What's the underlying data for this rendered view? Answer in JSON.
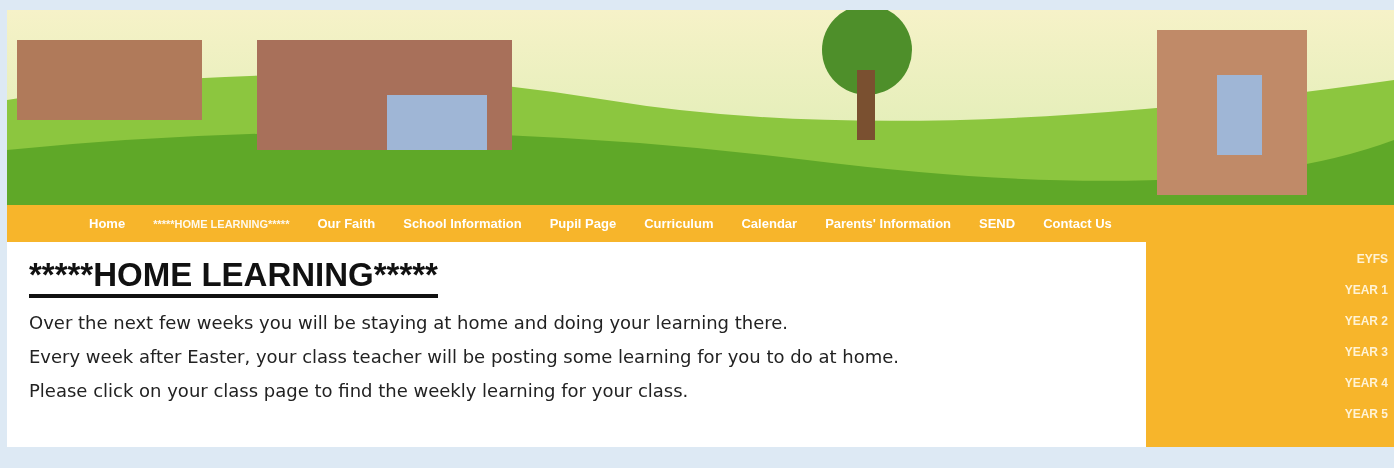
{
  "nav": [
    {
      "label": "Home",
      "selected": false
    },
    {
      "label": "*****HOME LEARNING*****",
      "selected": true
    },
    {
      "label": "Our Faith",
      "selected": false
    },
    {
      "label": "School Information",
      "selected": false
    },
    {
      "label": "Pupil Page",
      "selected": false
    },
    {
      "label": "Curriculum",
      "selected": false
    },
    {
      "label": "Calendar",
      "selected": false
    },
    {
      "label": "Parents' Information",
      "selected": false
    },
    {
      "label": "SEND",
      "selected": false
    },
    {
      "label": "Contact Us",
      "selected": false
    }
  ],
  "page": {
    "title": "*****HOME LEARNING*****",
    "paragraphs": [
      "Over the next few weeks you will be staying at home and doing your learning there.",
      "Every week after Easter, your class teacher will be posting some learning for you to do at home.",
      "Please click on your class page to find the weekly learning for your class."
    ]
  },
  "sidebar": {
    "items": [
      "EYFS",
      "YEAR 1",
      "YEAR 2",
      "YEAR 3",
      "YEAR 4",
      "YEAR 5"
    ]
  }
}
